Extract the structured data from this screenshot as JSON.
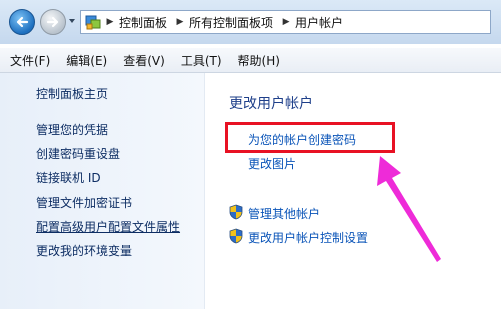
{
  "breadcrumb": {
    "items": [
      "控制面板",
      "所有控制面板项",
      "用户帐户"
    ]
  },
  "menubar": {
    "items": [
      "文件(F)",
      "编辑(E)",
      "查看(V)",
      "工具(T)",
      "帮助(H)"
    ]
  },
  "sidebar": {
    "home": "控制面板主页",
    "links": [
      "管理您的凭据",
      "创建密码重设盘",
      "链接联机 ID",
      "管理文件加密证书",
      "配置高级用户配置文件属性",
      "更改我的环境变量"
    ]
  },
  "main": {
    "title": "更改用户帐户",
    "links": [
      "为您的帐户创建密码",
      "更改图片",
      "管理其他帐户",
      "更改用户帐户控制设置"
    ]
  },
  "colors": {
    "highlight": "#e81123",
    "arrow": "#ee2bd8",
    "link": "#0a54b8"
  },
  "icons": [
    "back-arrow-icon",
    "forward-arrow-icon",
    "control-panel-icon",
    "uac-shield-icon"
  ]
}
